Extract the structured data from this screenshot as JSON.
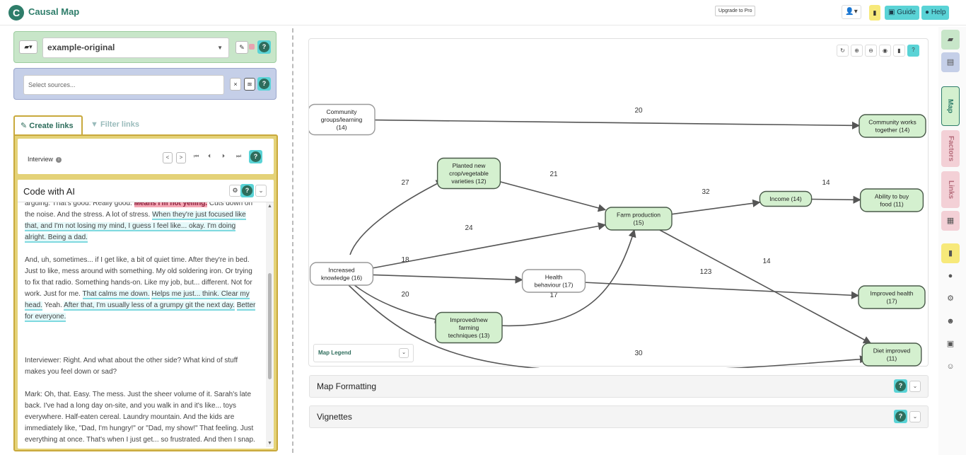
{
  "app": {
    "logo_letter": "C",
    "title": "Causal Map",
    "upgrade_label": "Upgrade to Pro",
    "user_label": "👤▾",
    "guide_label": "Guide",
    "help_label": "Help"
  },
  "project": {
    "name": "example-original",
    "folder_glyph": "▰▾",
    "edit_glyph": "✎",
    "help_glyph": "?"
  },
  "sources": {
    "placeholder": "Select sources...",
    "clear_glyph": "×",
    "layers_glyph": "≋"
  },
  "tabs": {
    "create": "Create links",
    "filter": "Filter links"
  },
  "interview": {
    "label": "Interview",
    "info_glyph": "i",
    "prev_glyph": "<",
    "next_glyph": ">",
    "first_glyph": "⏮",
    "back_glyph": "⏴",
    "fwd_glyph": "⏵",
    "last_glyph": "⏭"
  },
  "ai": {
    "title": "Code with AI",
    "gear_glyph": "⚙",
    "chevron_glyph": "⌄"
  },
  "transcript": {
    "p1_a": "arguing. That's good. Really good. ",
    "p1_pink": "Means I'm not yelling.",
    "p1_b": " Cuts down on the noise. And the stress. A lot of stress. ",
    "p1_hl": "When they're just focused like that, and I'm not losing my mind, I guess I feel like... okay. I'm doing alright. Being a dad.",
    "p2_a": "And, uh, sometimes... if I get like, a bit of quiet time. After they're in bed. Just to like, mess around with something. My old soldering iron. Or trying to fix that radio. Something hands-on. Like my job, but... different. Not for work. Just for me. ",
    "p2_hl1": "That calms me down.",
    "p2_hl2": "Helps me just... think. Clear my head.",
    "p2_b": " Yeah. ",
    "p2_hl3": "After that, I'm usually less of a grumpy git the next day.",
    "p2_hl4": "Better for everyone.",
    "p3": "Interviewer: Right. And what about the other side? What kind of stuff makes you feel down or sad?",
    "p4": "Mark: Oh, that. Easy. The mess. Just the sheer volume of it. Sarah's late back. I've had a long day on-site, and you walk in and it's like... toys everywhere. Half-eaten cereal. Laundry mountain. And the kids are immediately like, \"Dad, I'm hungry!\" or \"Dad, my show!\" That feeling. Just everything at once. That's when I just get... so frustrated. And then I snap."
  },
  "map": {
    "legend_label": "Map Legend",
    "tools": [
      "↻",
      "⊕",
      "⊖",
      "◉",
      "▮",
      "?"
    ],
    "nodes": [
      {
        "id": "community",
        "lines": [
          "Community",
          "groups/learning",
          "(14)"
        ],
        "style": "white"
      },
      {
        "id": "works",
        "lines": [
          "Community works",
          "together (14)"
        ],
        "style": "green"
      },
      {
        "id": "planted",
        "lines": [
          "Planted new",
          "crop/vegetable",
          "varieties (12)"
        ],
        "style": "green"
      },
      {
        "id": "farm",
        "lines": [
          "Farm production",
          "(15)"
        ],
        "style": "green"
      },
      {
        "id": "income",
        "lines": [
          "Income (14)"
        ],
        "style": "green"
      },
      {
        "id": "food",
        "lines": [
          "Ability to buy",
          "food (11)"
        ],
        "style": "green"
      },
      {
        "id": "knowledge",
        "lines": [
          "Increased",
          "knowledge (16)"
        ],
        "style": "white"
      },
      {
        "id": "health_beh",
        "lines": [
          "Health",
          "behaviour (17)"
        ],
        "style": "white"
      },
      {
        "id": "health_imp",
        "lines": [
          "Improved health",
          "(17)"
        ],
        "style": "green"
      },
      {
        "id": "farming",
        "lines": [
          "Improved/new",
          "farming",
          "techniques (13)"
        ],
        "style": "green"
      },
      {
        "id": "diet",
        "lines": [
          "Diet improved",
          "(11)"
        ],
        "style": "green"
      }
    ],
    "edges": [
      {
        "from": "community",
        "to": "works",
        "label": "20"
      },
      {
        "from": "knowledge",
        "to": "planted",
        "label": "27"
      },
      {
        "from": "planted",
        "to": "farm",
        "label": "21"
      },
      {
        "from": "knowledge",
        "to": "farm",
        "label": "24"
      },
      {
        "from": "farm",
        "to": "income",
        "label": "32"
      },
      {
        "from": "income",
        "to": "food",
        "label": "14"
      },
      {
        "from": "knowledge",
        "to": "health_beh",
        "label": "18"
      },
      {
        "from": "health_beh",
        "to": "health_imp",
        "label": "123"
      },
      {
        "from": "farm",
        "to": "diet",
        "label": "14"
      },
      {
        "from": "knowledge",
        "to": "farming",
        "label": "20"
      },
      {
        "from": "farming",
        "to": "farm",
        "label": "17"
      },
      {
        "from": "knowledge",
        "to": "diet",
        "label": "30"
      }
    ]
  },
  "accordions": {
    "formatting": "Map Formatting",
    "vignettes": "Vignettes"
  },
  "rail": {
    "folder_glyph": "▰",
    "doc_glyph": "▤",
    "map_tab": "Map",
    "factors_tab": "Factors",
    "links_tab": "Links",
    "table_glyph": "▦",
    "bookmark_glyph": "▮",
    "chat_glyph": "●",
    "gear_glyph": "⚙",
    "user_glyph": "☻",
    "robot_glyph": "▣",
    "user_check_glyph": "☺"
  },
  "colors": {
    "brand": "#2e7d6a",
    "accent_cyan": "#5ad3d6",
    "node_green": "#d4f0cf",
    "panel_gold": "#e4d278"
  }
}
